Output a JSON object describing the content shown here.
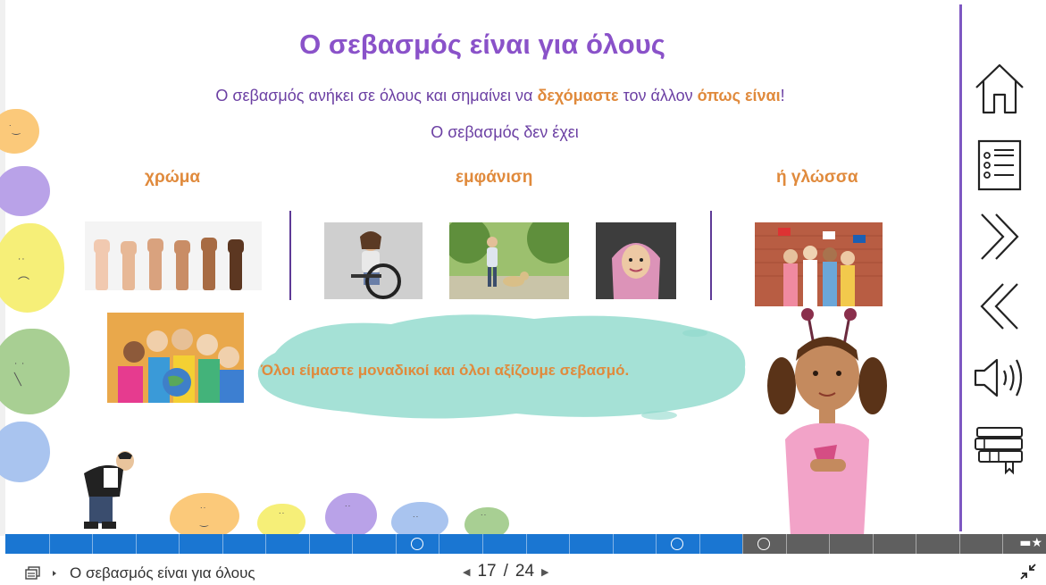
{
  "slide": {
    "title": "Ο σεβασμός είναι για όλους",
    "line1_a": "Ο σεβασμός ανήκει σε όλους και σημαίνει να ",
    "line1_b": "δεχόμαστε",
    "line1_c": " τον άλλον ",
    "line1_d": "όπως είναι",
    "line1_e": "!",
    "line2": "Ο σεβασμός δεν έχει",
    "categories": [
      "χρώμα",
      "εμφάνιση",
      "ή γλώσσα"
    ],
    "message": "Όλοι είμαστε μοναδικοί και όλοι αξίζουμε σεβασμό."
  },
  "nav": [
    "home-icon",
    "menu-list-icon",
    "next-icon",
    "previous-icon",
    "audio-icon",
    "library-icon"
  ],
  "footer": {
    "title": "Ο σεβασμός είναι για όλους",
    "current": "17",
    "separator": "/",
    "total": "24"
  },
  "progress": {
    "current": 17,
    "total": 24
  },
  "colors": {
    "accent": "#8a52c9",
    "orange": "#e08a3c",
    "progress": "#1a76d2"
  }
}
